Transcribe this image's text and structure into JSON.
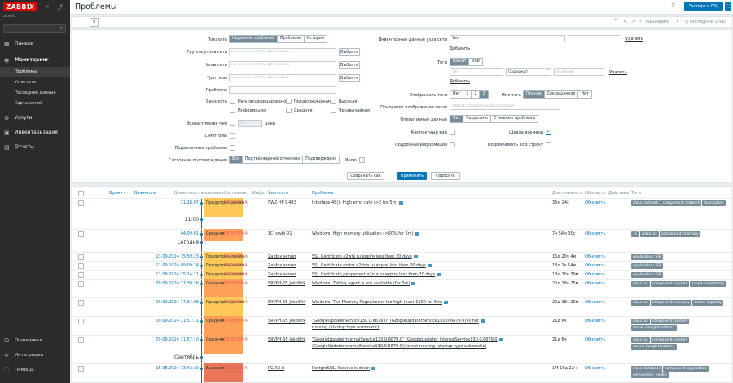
{
  "sidebar": {
    "logo": "ZABBIX",
    "server": "zbx01",
    "menu": [
      {
        "label": "Панели",
        "icon": "grid-icon"
      },
      {
        "label": "Мониторинг",
        "icon": "eye-icon"
      },
      {
        "label": "Услуги",
        "icon": "hierarchy-icon"
      },
      {
        "label": "Инвентаризация",
        "icon": "box-icon"
      },
      {
        "label": "Отчеты",
        "icon": "report-icon"
      }
    ],
    "submenu": [
      "Проблемы",
      "Узлы сети",
      "Последние данные",
      "Карты сетей"
    ],
    "footer": [
      {
        "label": "Поддержка",
        "icon": "headset-icon"
      },
      {
        "label": "Интеграции",
        "icon": "puzzle-icon"
      },
      {
        "label": "Помощь",
        "icon": "help-icon"
      }
    ]
  },
  "header": {
    "title": "Проблемы",
    "export": "Экспорт в CSV",
    "help": "?"
  },
  "filterbar": {
    "page_prev": "<",
    "page_next": ">",
    "range_label": "Расширить",
    "last_label": "Последний 1 час"
  },
  "filter": {
    "show_label": "Показать",
    "show_opts": [
      "Недавние проблемы",
      "Проблемы",
      "История"
    ],
    "hostgroups_label": "Группы узлов сети",
    "hosts_label": "Узлы сети",
    "triggers_label": "Триггеры",
    "placeholder": "начните печатать для поиска",
    "select": "Выбрать",
    "problem_label": "Проблема",
    "severity_label": "Важность",
    "severities": [
      "Не классифицировано",
      "Предупреждение",
      "Высокая",
      "Информация",
      "Средняя",
      "Чрезвычайная"
    ],
    "age_label": "Возраст менее чем",
    "age_value": "14",
    "age_unit": "дней",
    "symptoms_label": "Симптомы",
    "suppressed_label": "Подавленные проблемы",
    "ack_label": "Состояние подтверждения",
    "ack_opts": [
      "Все",
      "Подтверждение отменено",
      "Подтверждено"
    ],
    "ack_by_me": "Мною",
    "inv_label": "Инвентарные данные узла сети",
    "inv_field": "Тип",
    "remove": "Удалить",
    "add": "Добавить",
    "tags_label": "Теги",
    "tags_ops": [
      "И/ИЛИ",
      "Или"
    ],
    "tag_ph": "тег",
    "tag_cond": "Содержит",
    "tag_value_ph": "значение",
    "show_tags_label": "Отображать теги",
    "show_tags_opts": [
      "Нет",
      "1",
      "2",
      "3"
    ],
    "tag_name_label": "Имя тега",
    "tag_name_opts": [
      "Полное",
      "Сокращенное",
      "Нет"
    ],
    "priority_label": "Приоритет отображения тегов",
    "priority_ph": "список, разделенный запятыми",
    "opdata_label": "Оперативные данные",
    "opdata_opts": [
      "Нет",
      "Раздельно",
      "С именем проблемы"
    ],
    "compact_label": "Компактный вид",
    "timeline_label": "Шкала времени",
    "details_label": "Подробная информация",
    "highlight_label": "Подсвечивать всю строку",
    "save_as": "Сохранить как",
    "apply": "Применить",
    "reset": "Сбросить"
  },
  "table": {
    "headers": [
      "Время ▾",
      "Важность",
      "Время восстановления",
      "Состояние",
      "Инфо",
      "Узел сети",
      "Проблема",
      "Длительность",
      "Обновить",
      "Действия",
      "Теги"
    ],
    "groups": [
      "11:00",
      "Сегодня",
      "Сентябрь"
    ],
    "rows": [
      {
        "time": "11:28:07",
        "sev": "Предупреждение",
        "status": "ПРОБЛЕМА",
        "host": "SW2 HP P.4B3",
        "problem": "Interface 48(): High error rate (>2 for 5m)",
        "dur": "35м 24с",
        "upd": "Обновить",
        "tags": [
          "class: network",
          "component: network",
          "description"
        ]
      },
      {
        "time": "04:09:01",
        "sev": "Средняя",
        "status": "ПРОБЛЕМА",
        "host": "1C_srvbl-01",
        "problem": "Windows: High memory utilization (>90% for 5m)",
        "dur": "7ч 54м 30с",
        "upd": "Обновить",
        "tags": [
          "1C",
          "class: os",
          "component: memory"
        ]
      },
      {
        "time": "13.09.2024 15:59:23",
        "sev": "Предупреждение",
        "status": "ПРОБЛЕМА",
        "host": "Zabbix server",
        "problem": "SSL Certificate a2whi.ru expire less then 20 days",
        "dur": "16д 20ч 4м",
        "upd": "Обновить",
        "tags": [
          "Application: SSL"
        ]
      },
      {
        "time": "12.09.2024 09:09:14",
        "sev": "Предупреждение",
        "status": "ПРОБЛЕМА",
        "host": "Zabbix server",
        "problem": "SSL Certificate rostar.a2ktra.ru expire less then 20 days",
        "dur": "18д 2ч 54м",
        "upd": "Обновить",
        "tags": [
          "Application: SSL"
        ]
      },
      {
        "time": "11.09.2024 15:24:11",
        "sev": "Предупреждение",
        "status": "ПРОБЛЕМА",
        "host": "Zabbix server",
        "problem": "SSL Certificate pebpertest.a2nta.ru expire less then 20 days",
        "dur": "18д 20ч 39м",
        "upd": "Обновить",
        "tags": [
          "Application: SSL"
        ]
      },
      {
        "time": "09.09.2024 17:38:26",
        "sev": "Средняя",
        "status": "ПРОБЛЕМА",
        "host": "SRVPH-05 JekoWrk",
        "problem": "Windows: Zabbix agent is not available (for 3m)",
        "dur": "20д 18ч 25м",
        "upd": "Обновить",
        "tags": [
          "class: os",
          "component: system",
          "scope: availability"
        ]
      },
      {
        "time": "09.09.2024 17:34:08",
        "sev": "Предупреждение",
        "status": "ПРОБЛЕМА",
        "host": "SRVPH-05 JekoWrk",
        "problem": "Windows: The Memory Pages/sec is too high (over 1000 for 5m)",
        "dur": "20д 18ч 29м",
        "upd": "Обновить",
        "tags": [
          "class: os",
          "component: memory",
          "scope: capacity"
        ]
      },
      {
        "time": "09.09.2024 11:57:11",
        "sev": "Средняя",
        "status": "ПРОБЛЕМА",
        "host": "SRVPH-05 JekoWrk",
        "problem": "\"GoogleUpdaterService130.0.6679.0\" (GoogleUpdaterService130.0.6679.0) is not",
        "problem2": "running (startup type automatic)",
        "dur": "21д 6ч",
        "upd": "Обновить",
        "tags": [
          "class: os",
          "component: system",
          "name: GoogleUpdater..."
        ]
      },
      {
        "time": "09.09.2024 11:57:10",
        "sev": "Средняя",
        "status": "ПРОБЛЕМА",
        "host": "SRVPH-05 JekoWrk",
        "problem": "\"GoogleUpdaterInternalService130.0.6679.0\" (GoogleUpdater InternalService130.0.6679.0",
        "problem2": "(GoogleUpdaterInternalService130.0.6679.0)) is not running (startup type automatic)",
        "dur": "21д 6ч",
        "upd": "Обновить",
        "tags": [
          "class: os",
          "component: system",
          "name: GoogleUpdater..."
        ]
      },
      {
        "time": "15.08.2024 13:42:39",
        "sev": "Высокая",
        "status": "ПРОБЛЕМА",
        "host": "PG-A2-b",
        "problem": "PostgreSQL: Service is down",
        "dur": "1М 15д 22ч",
        "upd": "Обновить",
        "tags": [
          "class: database",
          "component: application",
          "component: health"
        ]
      }
    ]
  },
  "colors": {
    "warning": "#ffc859",
    "average": "#ffa059",
    "high": "#e97659",
    "accent": "#0275b8",
    "problem": "#e45959"
  }
}
